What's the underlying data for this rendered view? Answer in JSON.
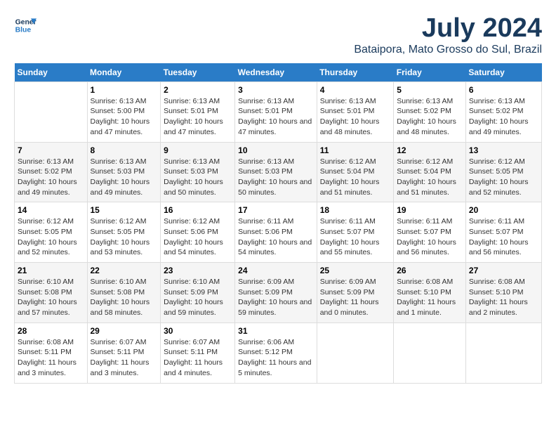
{
  "logo": {
    "line1": "General",
    "line2": "Blue"
  },
  "title": "July 2024",
  "subtitle": "Bataipora, Mato Grosso do Sul, Brazil",
  "weekdays": [
    "Sunday",
    "Monday",
    "Tuesday",
    "Wednesday",
    "Thursday",
    "Friday",
    "Saturday"
  ],
  "weeks": [
    [
      {
        "day": "",
        "sunrise": "",
        "sunset": "",
        "daylight": ""
      },
      {
        "day": "1",
        "sunrise": "6:13 AM",
        "sunset": "5:00 PM",
        "daylight": "10 hours and 47 minutes."
      },
      {
        "day": "2",
        "sunrise": "6:13 AM",
        "sunset": "5:01 PM",
        "daylight": "10 hours and 47 minutes."
      },
      {
        "day": "3",
        "sunrise": "6:13 AM",
        "sunset": "5:01 PM",
        "daylight": "10 hours and 47 minutes."
      },
      {
        "day": "4",
        "sunrise": "6:13 AM",
        "sunset": "5:01 PM",
        "daylight": "10 hours and 48 minutes."
      },
      {
        "day": "5",
        "sunrise": "6:13 AM",
        "sunset": "5:02 PM",
        "daylight": "10 hours and 48 minutes."
      },
      {
        "day": "6",
        "sunrise": "6:13 AM",
        "sunset": "5:02 PM",
        "daylight": "10 hours and 49 minutes."
      }
    ],
    [
      {
        "day": "7",
        "sunrise": "6:13 AM",
        "sunset": "5:02 PM",
        "daylight": "10 hours and 49 minutes."
      },
      {
        "day": "8",
        "sunrise": "6:13 AM",
        "sunset": "5:03 PM",
        "daylight": "10 hours and 49 minutes."
      },
      {
        "day": "9",
        "sunrise": "6:13 AM",
        "sunset": "5:03 PM",
        "daylight": "10 hours and 50 minutes."
      },
      {
        "day": "10",
        "sunrise": "6:13 AM",
        "sunset": "5:03 PM",
        "daylight": "10 hours and 50 minutes."
      },
      {
        "day": "11",
        "sunrise": "6:12 AM",
        "sunset": "5:04 PM",
        "daylight": "10 hours and 51 minutes."
      },
      {
        "day": "12",
        "sunrise": "6:12 AM",
        "sunset": "5:04 PM",
        "daylight": "10 hours and 51 minutes."
      },
      {
        "day": "13",
        "sunrise": "6:12 AM",
        "sunset": "5:05 PM",
        "daylight": "10 hours and 52 minutes."
      }
    ],
    [
      {
        "day": "14",
        "sunrise": "6:12 AM",
        "sunset": "5:05 PM",
        "daylight": "10 hours and 52 minutes."
      },
      {
        "day": "15",
        "sunrise": "6:12 AM",
        "sunset": "5:05 PM",
        "daylight": "10 hours and 53 minutes."
      },
      {
        "day": "16",
        "sunrise": "6:12 AM",
        "sunset": "5:06 PM",
        "daylight": "10 hours and 54 minutes."
      },
      {
        "day": "17",
        "sunrise": "6:11 AM",
        "sunset": "5:06 PM",
        "daylight": "10 hours and 54 minutes."
      },
      {
        "day": "18",
        "sunrise": "6:11 AM",
        "sunset": "5:07 PM",
        "daylight": "10 hours and 55 minutes."
      },
      {
        "day": "19",
        "sunrise": "6:11 AM",
        "sunset": "5:07 PM",
        "daylight": "10 hours and 56 minutes."
      },
      {
        "day": "20",
        "sunrise": "6:11 AM",
        "sunset": "5:07 PM",
        "daylight": "10 hours and 56 minutes."
      }
    ],
    [
      {
        "day": "21",
        "sunrise": "6:10 AM",
        "sunset": "5:08 PM",
        "daylight": "10 hours and 57 minutes."
      },
      {
        "day": "22",
        "sunrise": "6:10 AM",
        "sunset": "5:08 PM",
        "daylight": "10 hours and 58 minutes."
      },
      {
        "day": "23",
        "sunrise": "6:10 AM",
        "sunset": "5:09 PM",
        "daylight": "10 hours and 59 minutes."
      },
      {
        "day": "24",
        "sunrise": "6:09 AM",
        "sunset": "5:09 PM",
        "daylight": "10 hours and 59 minutes."
      },
      {
        "day": "25",
        "sunrise": "6:09 AM",
        "sunset": "5:09 PM",
        "daylight": "11 hours and 0 minutes."
      },
      {
        "day": "26",
        "sunrise": "6:08 AM",
        "sunset": "5:10 PM",
        "daylight": "11 hours and 1 minute."
      },
      {
        "day": "27",
        "sunrise": "6:08 AM",
        "sunset": "5:10 PM",
        "daylight": "11 hours and 2 minutes."
      }
    ],
    [
      {
        "day": "28",
        "sunrise": "6:08 AM",
        "sunset": "5:11 PM",
        "daylight": "11 hours and 3 minutes."
      },
      {
        "day": "29",
        "sunrise": "6:07 AM",
        "sunset": "5:11 PM",
        "daylight": "11 hours and 3 minutes."
      },
      {
        "day": "30",
        "sunrise": "6:07 AM",
        "sunset": "5:11 PM",
        "daylight": "11 hours and 4 minutes."
      },
      {
        "day": "31",
        "sunrise": "6:06 AM",
        "sunset": "5:12 PM",
        "daylight": "11 hours and 5 minutes."
      },
      {
        "day": "",
        "sunrise": "",
        "sunset": "",
        "daylight": ""
      },
      {
        "day": "",
        "sunrise": "",
        "sunset": "",
        "daylight": ""
      },
      {
        "day": "",
        "sunrise": "",
        "sunset": "",
        "daylight": ""
      }
    ]
  ],
  "labels": {
    "sunrise": "Sunrise:",
    "sunset": "Sunset:",
    "daylight": "Daylight:"
  }
}
